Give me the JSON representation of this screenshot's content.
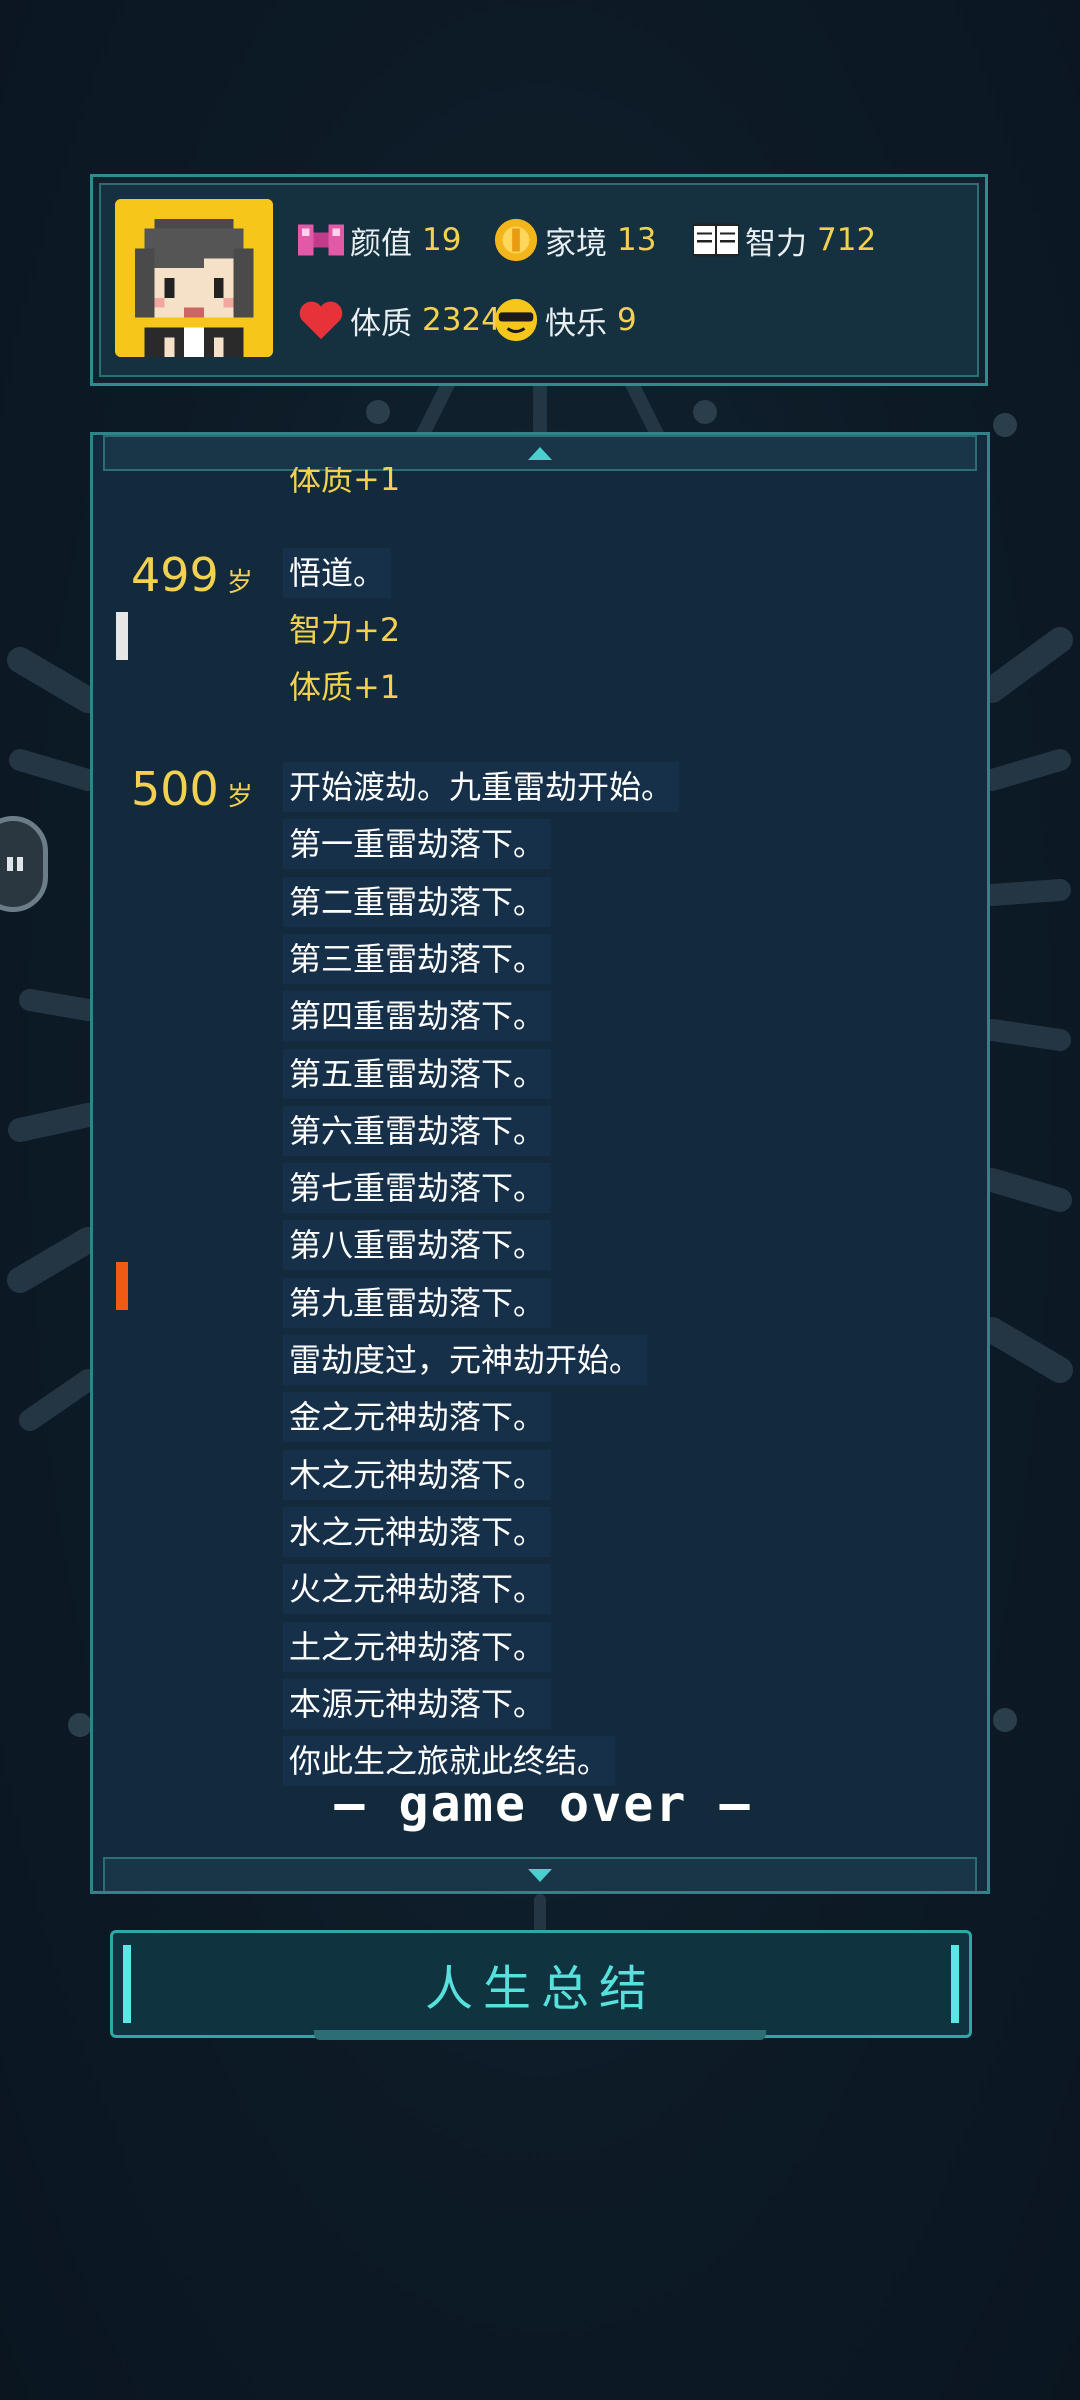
{
  "stats": [
    {
      "icon": "bow-icon",
      "label": "颜值",
      "value": "19"
    },
    {
      "icon": "coin-icon",
      "label": "家境",
      "value": "13"
    },
    {
      "icon": "book-icon",
      "label": "智力",
      "value": "712"
    },
    {
      "icon": "heart-icon",
      "label": "体质",
      "value": "2324"
    },
    {
      "icon": "sunglasses-icon",
      "label": "快乐",
      "value": "9"
    }
  ],
  "log": {
    "cut_line": "体质+1",
    "entries": [
      {
        "age": "499",
        "unit": "岁",
        "lines": [
          "悟道。"
        ],
        "attrs": [
          "智力+2",
          "体质+1"
        ]
      },
      {
        "age": "500",
        "unit": "岁",
        "lines": [
          "开始渡劫。九重雷劫开始。",
          "第一重雷劫落下。",
          "第二重雷劫落下。",
          "第三重雷劫落下。",
          "第四重雷劫落下。",
          "第五重雷劫落下。",
          "第六重雷劫落下。",
          "第七重雷劫落下。",
          "第八重雷劫落下。",
          "第九重雷劫落下。",
          "雷劫度过，元神劫开始。",
          "金之元神劫落下。",
          "木之元神劫落下。",
          "水之元神劫落下。",
          "火之元神劫落下。",
          "土之元神劫落下。",
          "本源元神劫落下。",
          "你此生之旅就此终结。"
        ],
        "attrs": []
      }
    ],
    "game_over": "— game over —"
  },
  "summary_button": "人生总结",
  "colors": {
    "accent": "#57e1dc",
    "value": "#f3d150",
    "frame": "#2e8489",
    "marker_orange": "#f05a14"
  }
}
